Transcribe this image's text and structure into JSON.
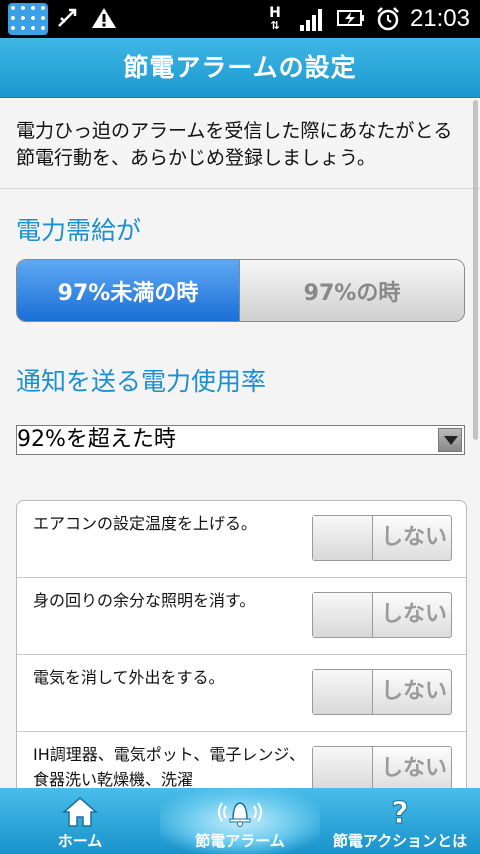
{
  "status_bar": {
    "time": "21:03",
    "network_letter": "H"
  },
  "header": {
    "title": "節電アラームの設定"
  },
  "intro_text": "電力ひっ迫のアラームを受信した際にあなたがとる節電行動を、あらかじめ登録しましょう。",
  "supply_section": {
    "title": "電力需給が",
    "options": [
      "97%未満の時",
      "97%の時"
    ],
    "selected_index": 0
  },
  "notify_section": {
    "title": "通知を送る電力使用率",
    "selected_value": "92%を超えた時"
  },
  "actions": [
    {
      "label": "エアコンの設定温度を上げる。",
      "toggle": "しない"
    },
    {
      "label": "身の回りの余分な照明を消す。",
      "toggle": "しない"
    },
    {
      "label": "電気を消して外出をする。",
      "toggle": "しない"
    },
    {
      "label": "IH調理器、電気ポット、電子レンジ、食器洗い乾燥機、洗濯",
      "toggle": "しない"
    }
  ],
  "bottom_nav": [
    {
      "label": "ホーム",
      "icon": "home-icon"
    },
    {
      "label": "節電アラーム",
      "icon": "alarm-bell-icon"
    },
    {
      "label": "節電アクションとは",
      "icon": "question-icon"
    }
  ],
  "colors": {
    "accent": "#1b8fd1",
    "header": "#1b98cf",
    "selected_segment": "#1a6fd6"
  }
}
